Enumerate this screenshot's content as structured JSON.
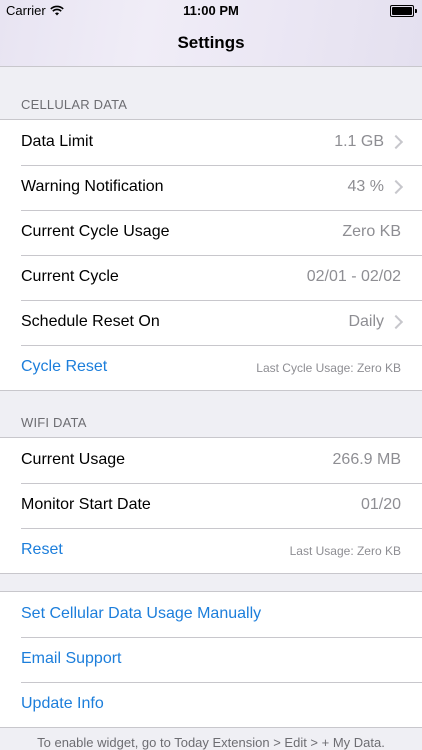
{
  "status_bar": {
    "carrier": "Carrier",
    "time": "11:00 PM"
  },
  "navbar": {
    "title": "Settings"
  },
  "cellular": {
    "header": "CELLULAR DATA",
    "rows": [
      {
        "label": "Data Limit",
        "value": "1.1 GB"
      },
      {
        "label": "Warning Notification",
        "value": "43 %"
      },
      {
        "label": "Current Cycle Usage",
        "value": "Zero KB"
      },
      {
        "label": "Current Cycle",
        "value": "02/01 - 02/02"
      },
      {
        "label": "Schedule Reset On",
        "value": "Daily"
      },
      {
        "label": "Cycle Reset",
        "note": "Last Cycle Usage: Zero KB"
      }
    ]
  },
  "wifi": {
    "header": "WIFI DATA",
    "rows": [
      {
        "label": "Current Usage",
        "value": "266.9 MB"
      },
      {
        "label": "Monitor Start Date",
        "value": "01/20"
      },
      {
        "label": "Reset",
        "note": "Last Usage: Zero KB"
      }
    ]
  },
  "actions": [
    {
      "label": "Set Cellular Data Usage Manually"
    },
    {
      "label": "Email Support"
    },
    {
      "label": "Update Info"
    }
  ],
  "footer": "To enable widget, go to Today Extension > Edit > + My Data.",
  "colors": {
    "link": "#1c7edb",
    "background": "#efeff4",
    "secondary": "#8e8e93"
  }
}
